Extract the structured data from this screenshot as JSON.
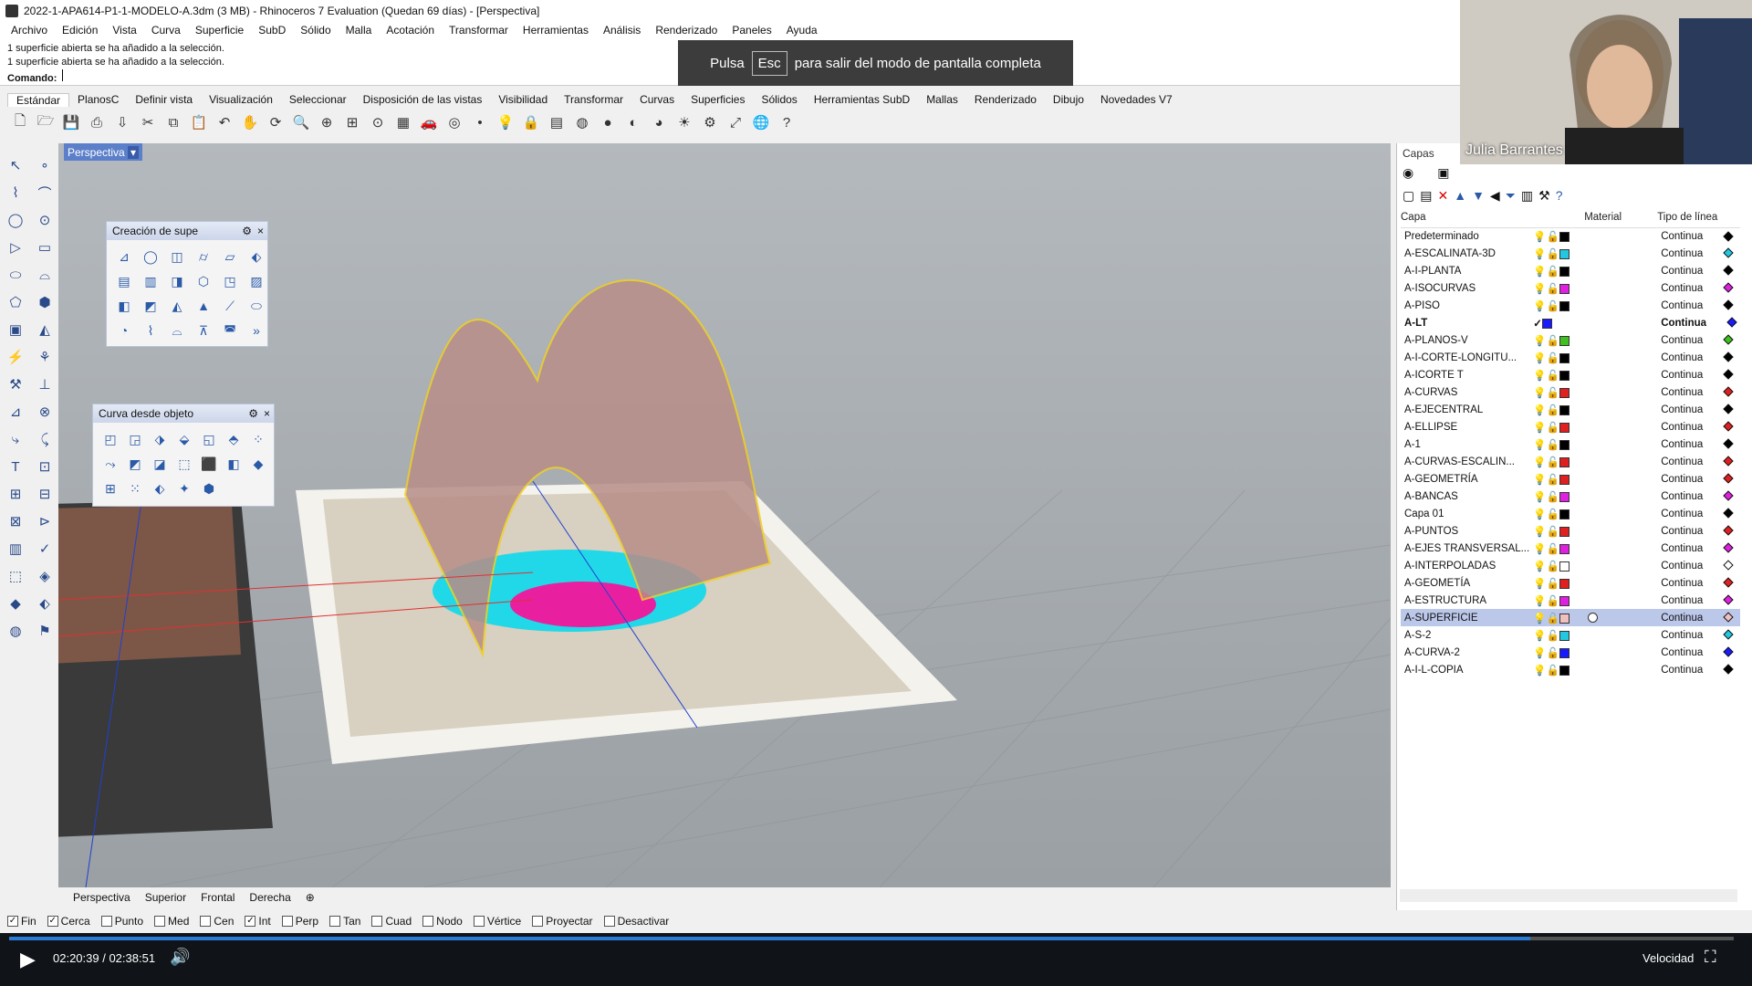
{
  "window": {
    "title": "2022-1-APA614-P1-1-MODELO-A.3dm (3 MB) - Rhinoceros 7 Evaluation (Quedan 69 días) - [Perspectiva]"
  },
  "menu": [
    "Archivo",
    "Edición",
    "Vista",
    "Curva",
    "Superficie",
    "SubD",
    "Sólido",
    "Malla",
    "Acotación",
    "Transformar",
    "Herramientas",
    "Análisis",
    "Renderizado",
    "Paneles",
    "Ayuda"
  ],
  "command": {
    "history": [
      "1 superficie abierta se ha añadido a la selección.",
      "1 superficie abierta se ha añadido a la selección."
    ],
    "prompt": "Comando:"
  },
  "fullscreen_banner": {
    "pre": "Pulsa",
    "key": "Esc",
    "post": "para salir del modo de pantalla completa"
  },
  "toolbar_tabs": [
    "Estándar",
    "PlanosC",
    "Definir vista",
    "Visualización",
    "Seleccionar",
    "Disposición de las vistas",
    "Visibilidad",
    "Transformar",
    "Curvas",
    "Superficies",
    "Sólidos",
    "Herramientas SubD",
    "Mallas",
    "Renderizado",
    "Dibujo",
    "Novedades V7"
  ],
  "toolbar_icons": [
    "new-icon",
    "open-icon",
    "save-icon",
    "print-icon",
    "import-icon",
    "cut-icon",
    "copy-icon",
    "paste-icon",
    "undo-icon",
    "pan-icon",
    "rotate-icon",
    "zoom-icon",
    "zoom-window-icon",
    "zoom-extents-icon",
    "zoom-selected-icon",
    "grid-icon",
    "car-icon",
    "camera-icon",
    "point-icon",
    "light-icon",
    "lock-icon",
    "layer-icon",
    "color-wheel-icon",
    "sphere-icon",
    "shaded-icon",
    "render-icon",
    "sun-icon",
    "gear-icon",
    "transform-icon",
    "globe-icon",
    "help-icon"
  ],
  "viewport": {
    "label": "Perspectiva"
  },
  "panel_surface": {
    "title": "Creación de supe"
  },
  "panel_curve": {
    "title": "Curva desde objeto"
  },
  "view_tabs": [
    "Perspectiva",
    "Superior",
    "Frontal",
    "Derecha"
  ],
  "osnaps": [
    {
      "label": "Fin",
      "checked": true
    },
    {
      "label": "Cerca",
      "checked": true
    },
    {
      "label": "Punto",
      "checked": false
    },
    {
      "label": "Med",
      "checked": false
    },
    {
      "label": "Cen",
      "checked": false
    },
    {
      "label": "Int",
      "checked": true
    },
    {
      "label": "Perp",
      "checked": false
    },
    {
      "label": "Tan",
      "checked": false
    },
    {
      "label": "Cuad",
      "checked": false
    },
    {
      "label": "Nodo",
      "checked": false
    },
    {
      "label": "Vértice",
      "checked": false
    },
    {
      "label": "Proyectar",
      "checked": false
    },
    {
      "label": "Desactivar",
      "checked": false
    }
  ],
  "layers_panel": {
    "title": "Capas",
    "columns": {
      "name": "Capa",
      "material": "Material",
      "linetype": "Tipo de línea"
    },
    "rows": [
      {
        "name": "Predeterminado",
        "color": "#000000",
        "linetype": "Continua"
      },
      {
        "name": "A-ESCALINATA-3D",
        "color": "#22c8e0",
        "linetype": "Continua"
      },
      {
        "name": "A-I-PLANTA",
        "color": "#000000",
        "linetype": "Continua"
      },
      {
        "name": "A-ISOCURVAS",
        "color": "#e020e0",
        "linetype": "Continua"
      },
      {
        "name": "A-PISO",
        "color": "#000000",
        "linetype": "Continua"
      },
      {
        "name": "A-LT",
        "color": "#1a1aff",
        "linetype": "Continua",
        "current": true
      },
      {
        "name": "A-PLANOS-V",
        "color": "#40c020",
        "linetype": "Continua"
      },
      {
        "name": "A-I-CORTE-LONGITU...",
        "color": "#000000",
        "linetype": "Continua"
      },
      {
        "name": "A-ICORTE T",
        "color": "#000000",
        "linetype": "Continua"
      },
      {
        "name": "A-CURVAS",
        "color": "#e02020",
        "linetype": "Continua"
      },
      {
        "name": "A-EJECENTRAL",
        "color": "#000000",
        "linetype": "Continua"
      },
      {
        "name": "A-ELLIPSE",
        "color": "#e02020",
        "linetype": "Continua"
      },
      {
        "name": "A-1",
        "color": "#000000",
        "linetype": "Continua"
      },
      {
        "name": "A-CURVAS-ESCALIN...",
        "color": "#e02020",
        "linetype": "Continua"
      },
      {
        "name": "A-GEOMETRÍA",
        "color": "#e02020",
        "linetype": "Continua"
      },
      {
        "name": "A-BANCAS",
        "color": "#e020e0",
        "linetype": "Continua"
      },
      {
        "name": "Capa 01",
        "color": "#000000",
        "linetype": "Continua"
      },
      {
        "name": "A-PUNTOS",
        "color": "#e02020",
        "linetype": "Continua"
      },
      {
        "name": "A-EJES TRANSVERSAL...",
        "color": "#e020e0",
        "linetype": "Continua"
      },
      {
        "name": "A-INTERPOLADAS",
        "color": "#ffffff",
        "linetype": "Continua"
      },
      {
        "name": "A-GEOMETÍA",
        "color": "#e02020",
        "linetype": "Continua"
      },
      {
        "name": "A-ESTRUCTURA",
        "color": "#e020e0",
        "linetype": "Continua"
      },
      {
        "name": "A-SUPERFICIE",
        "color": "#f0c0c0",
        "linetype": "Continua",
        "selected": true
      },
      {
        "name": "A-S-2",
        "color": "#22c8e0",
        "linetype": "Continua"
      },
      {
        "name": "A-CURVA-2",
        "color": "#1a1aff",
        "linetype": "Continua"
      },
      {
        "name": "A-I-L-COPIA",
        "color": "#000000",
        "linetype": "Continua"
      }
    ]
  },
  "webcam": {
    "name": "Julia Barrantes"
  },
  "player": {
    "time": "02:20:39 / 02:38:51",
    "speed_label": "Velocidad",
    "progress": 0.882
  }
}
